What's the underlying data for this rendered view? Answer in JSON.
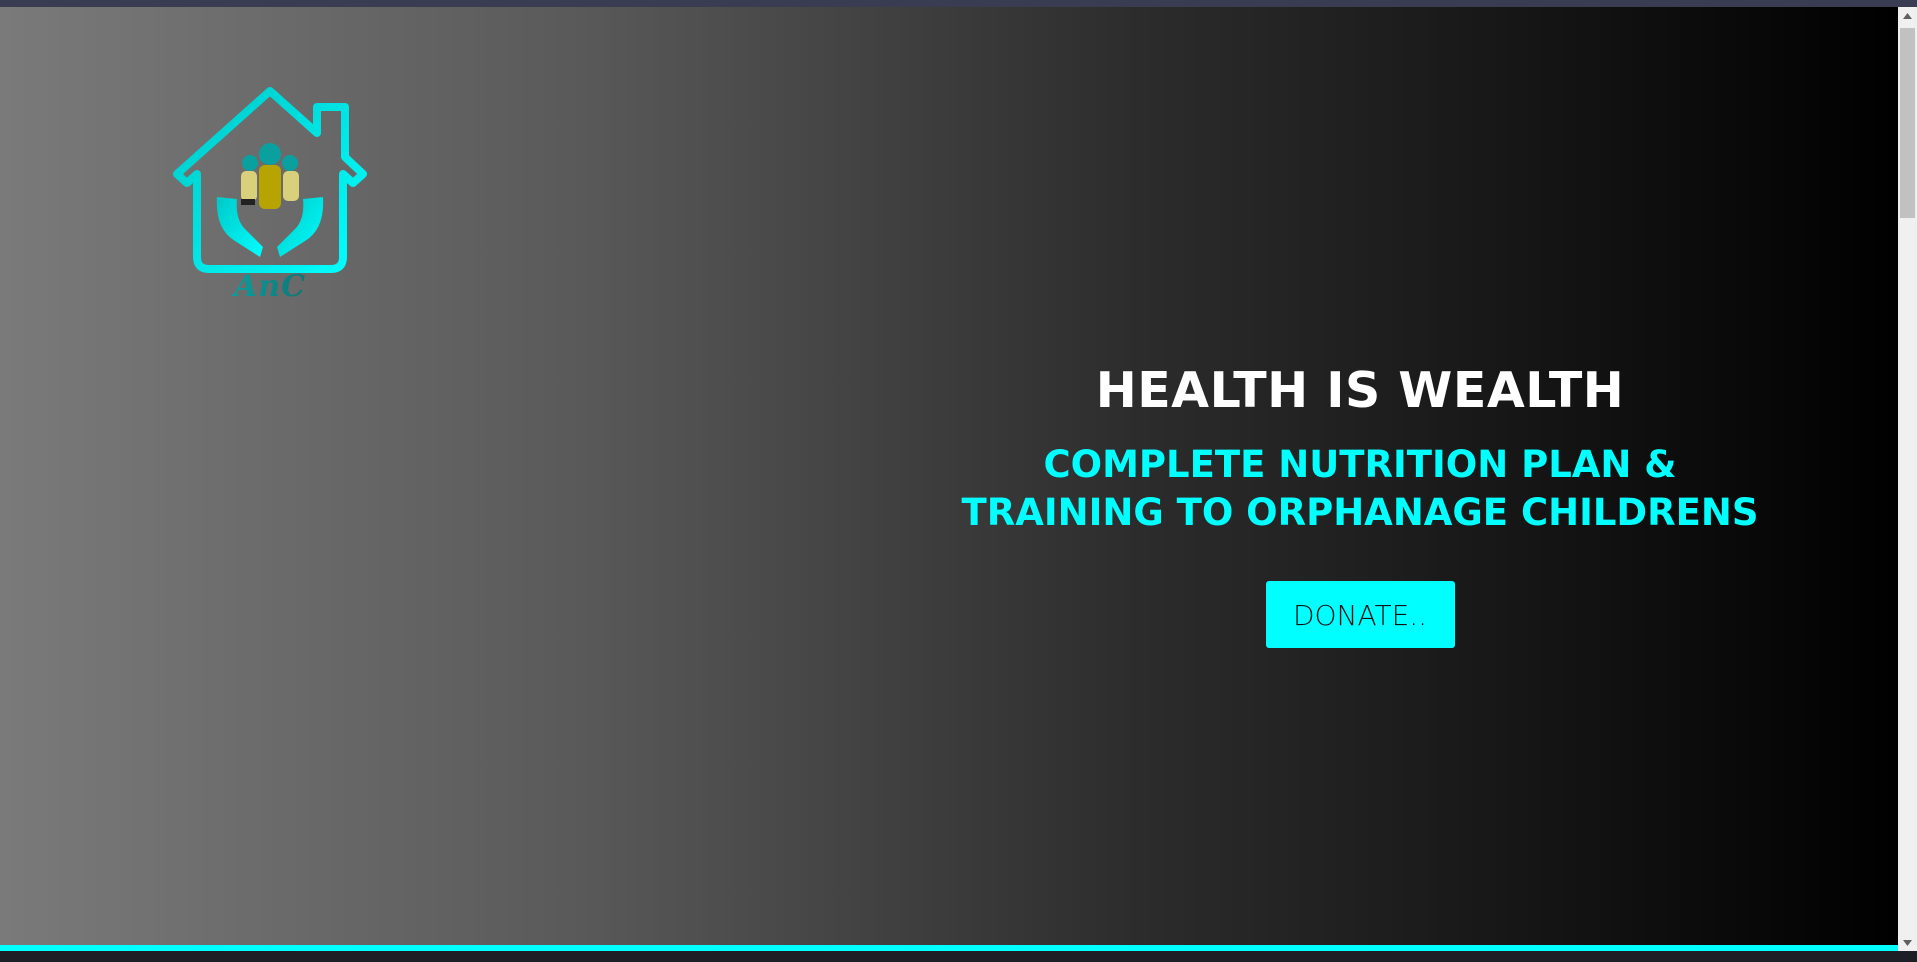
{
  "logo": {
    "text": "AnC",
    "icon_name": "house-hands-children-logo",
    "primary_color": "#00e5e5",
    "figure_color": "#b8a400"
  },
  "hero": {
    "headline": "HEALTH IS WEALTH",
    "subheadline": "COMPLETE NUTRITION PLAN & TRAINING TO ORPHANAGE CHILDRENS",
    "donate_label": "DONATE.."
  },
  "colors": {
    "accent": "#00ffff",
    "gradient_start": "#7a7a7a",
    "gradient_end": "#000000",
    "headline": "#ffffff"
  },
  "scrollbar": {
    "up_icon": "triangle-up-icon",
    "down_icon": "triangle-down-icon"
  }
}
